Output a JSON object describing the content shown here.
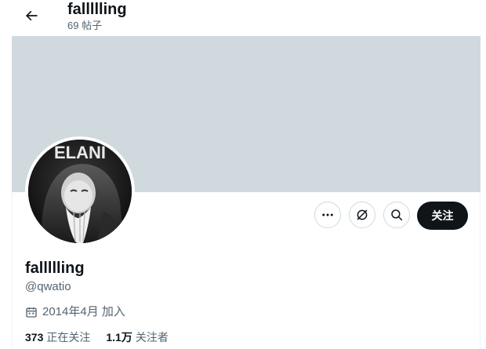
{
  "header": {
    "name": "fallllling",
    "posts": "69 帖子"
  },
  "profile": {
    "name": "fallllling",
    "handle": "@qwatio",
    "joined": "2014年4月 加入",
    "following_count": "373",
    "following_label": "正在关注",
    "followers_count": "1.1万",
    "followers_label": "关注者"
  },
  "actions": {
    "follow_label": "关注"
  },
  "avatar": {
    "banner_text": "ELANI"
  },
  "colors": {
    "banner": "#cfd9de",
    "follow_button": "#0f1419",
    "secondary_text": "#536471"
  }
}
